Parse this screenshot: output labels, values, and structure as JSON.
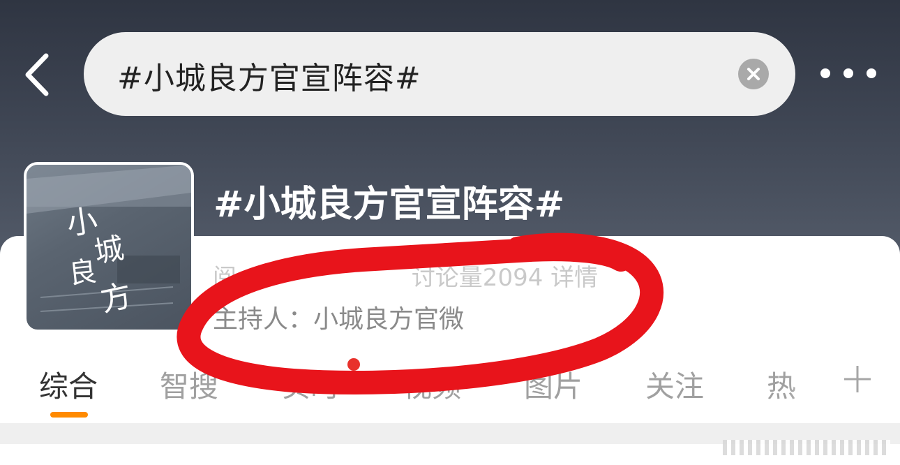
{
  "topbar": {
    "search_value": "#小城良方官宣阵容#",
    "back_icon": "chevron-left-icon",
    "clear_icon": "clear-icon",
    "more_icon": "more-horizontal-icon"
  },
  "topic": {
    "title": "#小城良方官宣阵容#",
    "cover_calligraphy": "小城良方",
    "stats_partial_left": "阅",
    "stats_partial_mid": "讨论量2094",
    "stats_details_label": "详情",
    "host_label": "主持人：",
    "host_name": "小城良方官微"
  },
  "tabs": [
    {
      "label": "综合",
      "active": true
    },
    {
      "label": "智搜",
      "active": false
    },
    {
      "label": "实时",
      "active": false,
      "dot": true
    },
    {
      "label": "视频",
      "active": false
    },
    {
      "label": "图片",
      "active": false
    },
    {
      "label": "关注",
      "active": false
    },
    {
      "label": "热",
      "active": false
    }
  ],
  "colors": {
    "accent_underline": "#ff8a00",
    "annotation_red": "#e8141b",
    "notification_dot": "#e8312b"
  }
}
